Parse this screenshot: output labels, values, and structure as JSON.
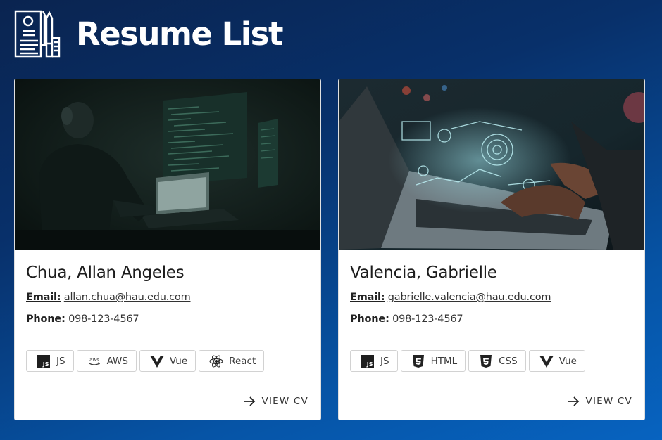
{
  "header": {
    "title": "Resume List",
    "icon": "resume-document-icon"
  },
  "cards": [
    {
      "name": "Chua, Allan Angeles",
      "email_label": "Email:",
      "email": "allan.chua@hau.edu.com",
      "phone_label": "Phone:",
      "phone": "098-123-4567",
      "image": "developer-at-monitors-photo",
      "skills": [
        {
          "label": "JS",
          "icon": "js-icon"
        },
        {
          "label": "AWS",
          "icon": "aws-icon"
        },
        {
          "label": "Vue",
          "icon": "vue-icon"
        },
        {
          "label": "React",
          "icon": "react-icon"
        }
      ],
      "action_label": "VIEW CV"
    },
    {
      "name": "Valencia, Gabrielle",
      "email_label": "Email:",
      "email": "gabrielle.valencia@hau.edu.com",
      "phone_label": "Phone:",
      "phone": "098-123-4567",
      "image": "laptop-holographic-ui-photo",
      "skills": [
        {
          "label": "JS",
          "icon": "js-icon"
        },
        {
          "label": "HTML",
          "icon": "html5-icon"
        },
        {
          "label": "CSS",
          "icon": "css3-icon"
        },
        {
          "label": "Vue",
          "icon": "vue-icon"
        }
      ],
      "action_label": "VIEW CV"
    }
  ],
  "colors": {
    "background_start": "#0a2450",
    "background_end": "#0763c0",
    "card": "#ffffff",
    "chip_border": "#d2d2d2"
  }
}
